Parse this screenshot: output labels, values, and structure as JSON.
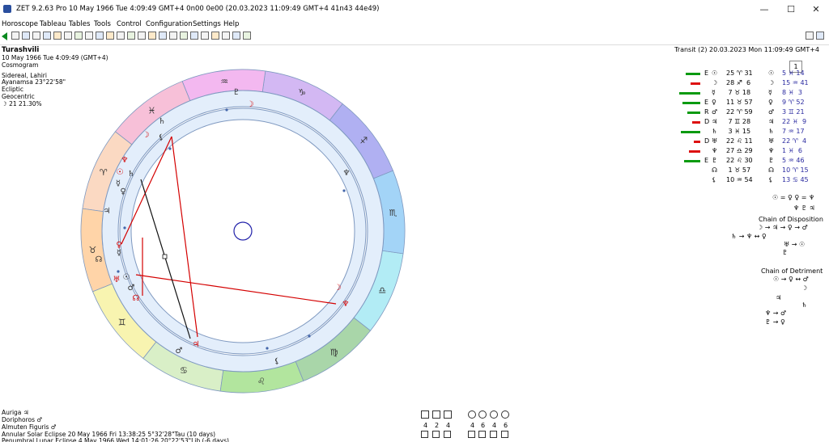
{
  "window": {
    "title": "ZET 9.2.63 Pro   10 May 1966  Tue   4:09:49 GMT+4 0n00  0e00   (20.03.2023  11:09:49 GMT+4 41n43 44e49)",
    "minimize": "—",
    "maximize": "☐",
    "close": "✕"
  },
  "menu": [
    "Horoscope",
    "Tableau",
    "Tables",
    "Tools",
    "Control",
    "Configuration",
    "Settings",
    "Help"
  ],
  "toolbar": {
    "spin_value": "1"
  },
  "chart_info": {
    "name": "Turashvili",
    "date": "10 May 1966   Tue    4:09:49 (GMT+4)",
    "type": "Cosmogram",
    "zodiac": "Sidereal, Lahiri",
    "ayanamsa": "Ayanamsa 23°22'58\"",
    "coordinates": "Ecliptic",
    "center": "Geocentric",
    "moon_phase": "☽   21  21.30%"
  },
  "transit": "Transit (2) 20.03.2023   Mon 11:09:49 GMT+4",
  "aspect_table": [
    {
      "bar": 18,
      "bar_color": "#0a9a10",
      "mark": "E",
      "g1": "☉",
      "v1": "25 ♈ 31",
      "g2": "☉",
      "v2": "5 ♓ 14"
    },
    {
      "bar": 12,
      "bar_color": "#dd1010",
      "mark": "",
      "g1": "☽",
      "v1": "28 ♐  6",
      "g2": "☽",
      "v2": "15 ♒ 41"
    },
    {
      "bar": 26,
      "bar_color": "#0a9a10",
      "mark": "",
      "g1": "☿",
      "v1": " 7 ♉ 18",
      "g2": "☿",
      "v2": "8 ♓  3"
    },
    {
      "bar": 22,
      "bar_color": "#0a9a10",
      "mark": "E",
      "g1": "♀",
      "v1": "11 ♉ 57",
      "g2": "♀",
      "v2": "9 ♈ 52"
    },
    {
      "bar": 16,
      "bar_color": "#0a9a10",
      "mark": "R",
      "g1": "♂",
      "v1": "22 ♈ 59",
      "g2": "♂",
      "v2": "3 ♊ 21"
    },
    {
      "bar": 10,
      "bar_color": "#dd1010",
      "mark": "D",
      "g1": "♃",
      "v1": " 7 ♊ 28",
      "g2": "♃",
      "v2": "22 ♓  9"
    },
    {
      "bar": 24,
      "bar_color": "#0a9a10",
      "mark": "",
      "g1": "♄",
      "v1": " 3 ♓ 15",
      "g2": "♄",
      "v2": "7 ♒ 17"
    },
    {
      "bar": 8,
      "bar_color": "#dd1010",
      "mark": "D",
      "g1": "♅",
      "v1": "22 ♌ 11",
      "g2": "♅",
      "v2": "22 ♈  4"
    },
    {
      "bar": 14,
      "bar_color": "#dd1010",
      "mark": "",
      "g1": "♆",
      "v1": "27 ♎ 29",
      "g2": "♆",
      "v2": "1 ♓  6"
    },
    {
      "bar": 20,
      "bar_color": "#0a9a10",
      "mark": "E",
      "g1": "♇",
      "v1": "22 ♌ 30",
      "g2": "♇",
      "v2": "5 ♒ 46"
    },
    {
      "bar": 0,
      "bar_color": "#0a9a10",
      "mark": "",
      "g1": "☊",
      "v1": " 1 ♉ 57",
      "g2": "☊",
      "v2": "10 ♈ 15"
    },
    {
      "bar": 0,
      "bar_color": "#0a9a10",
      "mark": "",
      "g1": "⚸",
      "v1": "10 ♒ 54",
      "g2": "⚸",
      "v2": "13 ♋ 45"
    }
  ],
  "chains": {
    "top_line1": "☉ = ♀ ♀ = ♆",
    "top_line2": "♆ ♇ ♃",
    "disposition_label": "Chain of Disposition",
    "disp_line1": "☽ → ♃ → ♀ → ♂",
    "disp_line2": "♄ → ♆ ↔ ♀",
    "disp_line3": "♅ → ☉",
    "disp_line4": "♇",
    "detriment_label": "Chain of Detriment",
    "det_line1": "☉ → ♀ ↔ ♂",
    "det_line2": "☽",
    "det_line3": "♃",
    "det_line4": "♄",
    "det_line5": "♆ → ♂",
    "det_line6": "♇ → ♀"
  },
  "bottom": {
    "auriga": "Auriga  ♃",
    "doriphoros": "Doriphoros  ♂",
    "almuten": "Almuten Figuris  ♂",
    "eclipse": "Annular Solar Eclipse 20 May 1966 Fri 13:38:25  5°32'28\"Tau (10 days)",
    "eclipse2": "Penumbral Lunar Eclipse 4 May 1966 Wed 14:01:26  20°22'53\"Lib (-6 days)",
    "pattern_counts": [
      "4",
      "2",
      "4",
      "4",
      "6",
      "4",
      "6"
    ]
  },
  "colors": {
    "aries": "#fbd9c2",
    "taurus": "#ffd4a8",
    "gemini": "#f8f4b0",
    "cancer": "#d9efc7",
    "leo": "#b2e59e",
    "virgo": "#a9d6a9",
    "libra": "#b2ecf5",
    "scorpio": "#a3d4f7",
    "sagittarius": "#b0b0f2",
    "capricorn": "#d3b8f3",
    "aquarius": "#f3b8f0",
    "pisces": "#f7c0d8",
    "ring": "#e3eefb",
    "ring_stroke": "#7f99c0",
    "aspect_red": "#d40000"
  },
  "signs": [
    "♈",
    "♉",
    "♊",
    "♋",
    "♌",
    "♍",
    "♎",
    "♏",
    "♐",
    "♑",
    "♒",
    "♓"
  ]
}
